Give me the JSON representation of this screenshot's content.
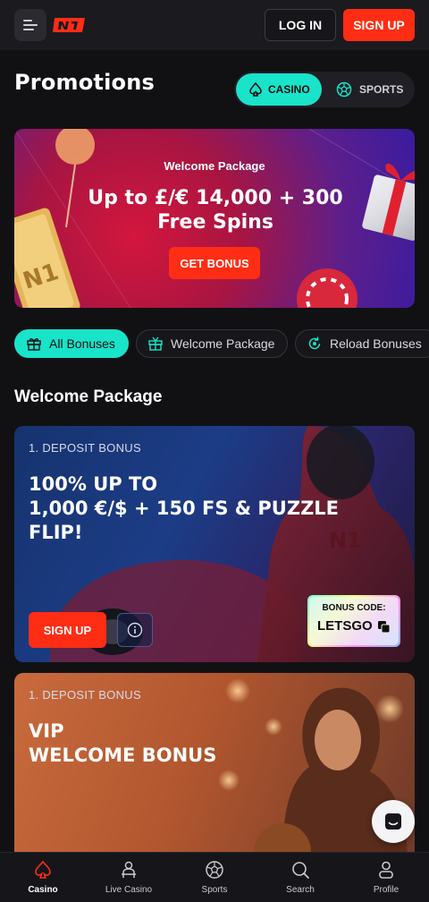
{
  "header": {
    "logo_text": "N1",
    "login_label": "LOG IN",
    "signup_label": "SIGN UP"
  },
  "page": {
    "title": "Promotions",
    "toggle": {
      "casino": "CASINO",
      "sports": "SPORTS",
      "selected": "casino"
    }
  },
  "hero": {
    "subtitle": "Welcome Package",
    "headline_line1": "Up to £/€ 14,000 + 300",
    "headline_line2": "Free Spins",
    "cta": "GET BONUS"
  },
  "filters": [
    {
      "label": "All Bonuses",
      "icon": "gift-icon",
      "active": true
    },
    {
      "label": "Welcome Package",
      "icon": "gift-box-icon",
      "active": false
    },
    {
      "label": "Reload Bonuses",
      "icon": "reload-icon",
      "active": false
    }
  ],
  "section": {
    "title": "Welcome Package"
  },
  "cards": [
    {
      "label": "1. DEPOSIT BONUS",
      "title_lines": [
        "100% UP TO",
        "1,000 €/$ + 150 FS & PUZZLE",
        "FLIP!"
      ],
      "signup": "SIGN UP",
      "bonus_code_caption": "BONUS CODE:",
      "bonus_code": "LETSGO"
    },
    {
      "label": "1. DEPOSIT BONUS",
      "title_lines": [
        "VIP",
        "WELCOME BONUS"
      ]
    }
  ],
  "bottom_nav": [
    {
      "label": "Casino",
      "icon": "spade-icon",
      "active": true
    },
    {
      "label": "Live Casino",
      "icon": "dealer-icon",
      "active": false
    },
    {
      "label": "Sports",
      "icon": "soccer-ball-icon",
      "active": false
    },
    {
      "label": "Search",
      "icon": "search-icon",
      "active": false
    },
    {
      "label": "Profile",
      "icon": "user-icon",
      "active": false
    }
  ],
  "colors": {
    "accent": "#19e3c9",
    "brand_red": "#ff2d14",
    "background": "#111114"
  }
}
